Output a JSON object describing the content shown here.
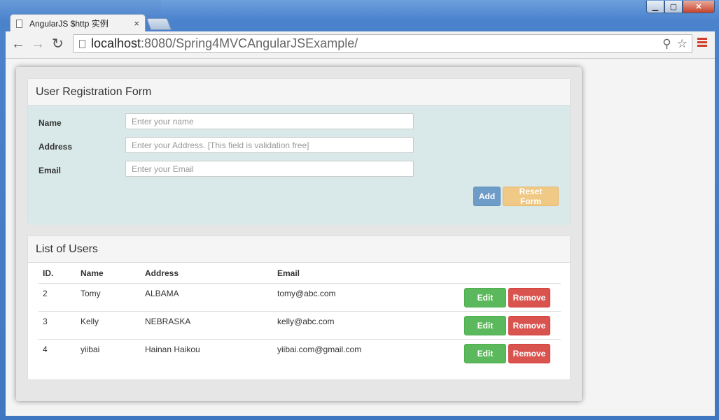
{
  "browser": {
    "tab_title": "AngularJS $http 实例",
    "tab_close": "×",
    "url_host": "localhost",
    "url_rest": ":8080/Spring4MVCAngularJSExample/"
  },
  "form": {
    "title": "User Registration Form",
    "fields": [
      {
        "label": "Name",
        "placeholder": "Enter your name"
      },
      {
        "label": "Address",
        "placeholder": "Enter your Address. [This field is validation free]"
      },
      {
        "label": "Email",
        "placeholder": "Enter your Email"
      }
    ],
    "add_label": "Add",
    "reset_label": "Reset Form"
  },
  "users": {
    "title": "List of Users",
    "columns": [
      "ID.",
      "Name",
      "Address",
      "Email"
    ],
    "rows": [
      {
        "id": "2",
        "name": "Tomy",
        "address": "ALBAMA",
        "email": "tomy@abc.com"
      },
      {
        "id": "3",
        "name": "Kelly",
        "address": "NEBRASKA",
        "email": "kelly@abc.com"
      },
      {
        "id": "4",
        "name": "yiibai",
        "address": "Hainan Haikou",
        "email": "yiibai.com@gmail.com"
      }
    ],
    "edit_label": "Edit",
    "remove_label": "Remove"
  },
  "colors": {
    "add": "#6d9cc9",
    "reset": "#efc985",
    "edit": "#5cb85c",
    "remove": "#d9534f",
    "form_body": "#d9e8e8"
  },
  "icons": [
    "back-icon",
    "forward-icon",
    "reload-icon",
    "page-icon",
    "zoom-icon",
    "star-icon",
    "menu-icon",
    "minimize-icon",
    "maximize-icon",
    "close-icon"
  ]
}
